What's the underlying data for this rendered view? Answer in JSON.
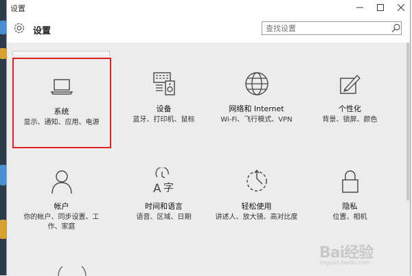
{
  "window": {
    "title": "设置"
  },
  "header": {
    "title": "设置",
    "search_placeholder": "查找设置"
  },
  "tiles": [
    {
      "name": "系统",
      "desc": "显示、通知、应用、电源"
    },
    {
      "name": "设备",
      "desc": "蓝牙、打印机、鼠标"
    },
    {
      "name": "网络和 Internet",
      "desc": "Wi-Fi、飞行模式、VPN"
    },
    {
      "name": "个性化",
      "desc": "背景、锁屏、颜色"
    },
    {
      "name": "帐户",
      "desc": "你的帐户、同步设置、工作、家庭"
    },
    {
      "name": "时间和语言",
      "desc": "语音、区域、日期"
    },
    {
      "name": "轻松使用",
      "desc": "讲述人、放大镜、高对比度"
    },
    {
      "name": "隐私",
      "desc": "位置、相机"
    }
  ],
  "watermark": {
    "brand": "Bai经验",
    "url": "jingyan.baidu.com"
  }
}
